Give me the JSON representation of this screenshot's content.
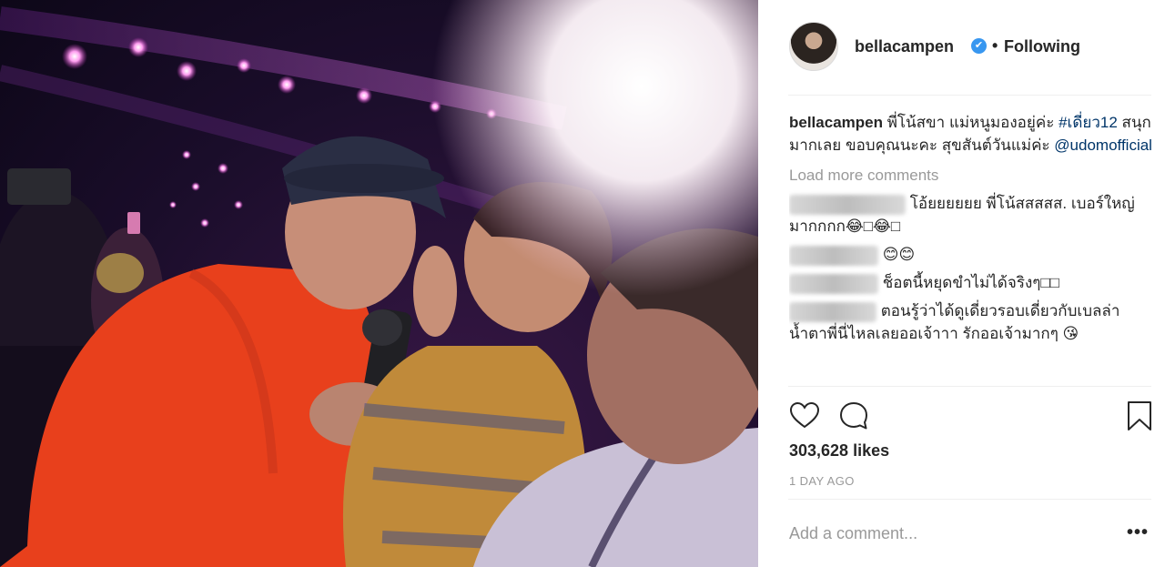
{
  "post": {
    "username": "bellacampen",
    "follow_status": "Following",
    "separator": "•",
    "verified_mark": "✔"
  },
  "caption": {
    "username": "bellacampen",
    "text_1": " พี่โน้สขา แม่หนูมองอยู่ค่ะ ",
    "hashtag": "#เดี่ยว12",
    "text_2": " สนุกมากเลย ขอบคุณนะคะ สุขสันต์วันแม่ค่ะ ",
    "mention": "@udomofficial"
  },
  "load_more": "Load more comments",
  "comments": [
    {
      "text": " โอ้ยยยยยย พี่โน้สสสสส. เบอร์ใหญ่มากกกก😂□😂□"
    },
    {
      "text": " 😊😊"
    },
    {
      "text": " ช็อตนี้หยุดขำไม่ได้จริงๆ□□"
    },
    {
      "text": " ตอนรู้ว่าได้ดูเดี่ยวรอบเดี่ยวกับเบลล่า น้ำตาพี่นี่ไหลเลยออเจ้าาา รักออเจ้ามากๆ 😘"
    }
  ],
  "likes": "303,628 likes",
  "timestamp": "1 DAY AGO",
  "add_comment_placeholder": "Add a comment...",
  "more_options": "•••",
  "icons": {
    "like": "heart-icon",
    "comment": "comment-bubble-icon",
    "save": "bookmark-icon"
  },
  "colors": {
    "link": "#003569",
    "verified": "#3897f0",
    "muted": "#999999",
    "shirt": "#e8401c"
  }
}
